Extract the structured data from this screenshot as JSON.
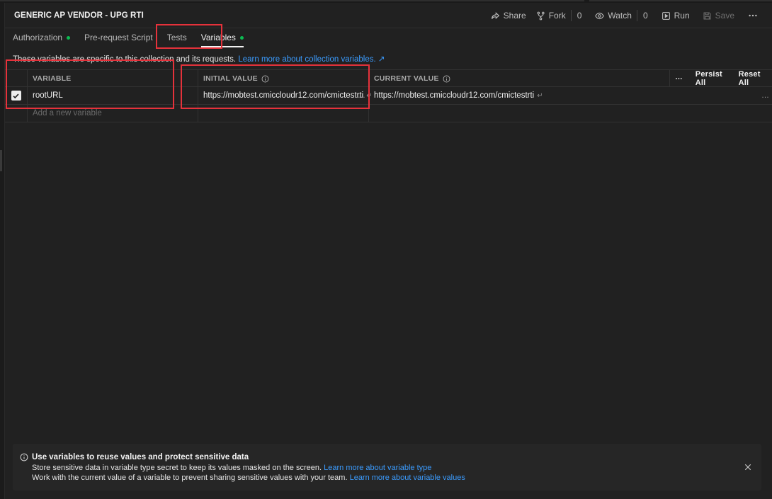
{
  "header": {
    "title": "GENERIC AP VENDOR - UPG RTI",
    "share_label": "Share",
    "fork_label": "Fork",
    "fork_count": "0",
    "watch_label": "Watch",
    "watch_count": "0",
    "run_label": "Run",
    "save_label": "Save"
  },
  "tabs": [
    {
      "label": "Authorization",
      "dot": true
    },
    {
      "label": "Pre-request Script",
      "dot": false
    },
    {
      "label": "Tests",
      "dot": false
    },
    {
      "label": "Variables",
      "dot": true,
      "active": true
    }
  ],
  "description": {
    "text": "These variables are specific to this collection and its requests.",
    "link": "Learn more about collection variables. ↗"
  },
  "table": {
    "headers": {
      "variable": "VARIABLE",
      "initial": "INITIAL VALUE",
      "current": "CURRENT VALUE",
      "persist_all": "Persist All",
      "reset_all": "Reset All"
    },
    "rows": [
      {
        "checked": true,
        "variable": "rootURL",
        "initial": "https://mobtest.cmiccloudr12.com/cmictestrti",
        "current": "https://mobtest.cmiccloudr12.com/cmictestrti"
      }
    ],
    "new_variable_placeholder": "Add a new variable"
  },
  "banner": {
    "title": "Use variables to reuse values and protect sensitive data",
    "line1_text": "Store sensitive data in variable type secret to keep its values masked on the screen.",
    "line1_link": "Learn more about variable type",
    "line2_text": "Work with the current value of a variable to prevent sharing sensitive values with your team.",
    "line2_link": "Learn more about variable values"
  },
  "colors": {
    "background": "#212121",
    "accent_link": "#3b9cff",
    "status_dot": "#0cbb52",
    "highlight": "#e5323b"
  }
}
